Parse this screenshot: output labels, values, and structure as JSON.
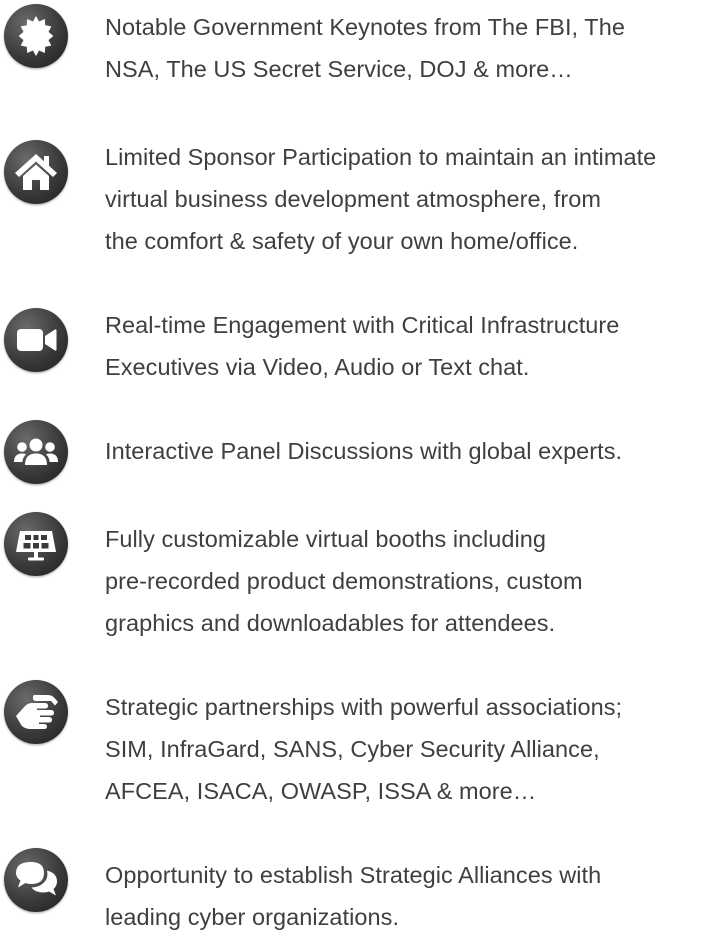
{
  "features": [
    {
      "icon": "badge-star-icon",
      "lines": [
        "Notable Government Keynotes from The FBI, The",
        "NSA, The US Secret Service, DOJ & more…"
      ]
    },
    {
      "icon": "home-icon",
      "lines": [
        "Limited Sponsor Participation to maintain an intimate",
        "virtual business development atmosphere, from",
        "the comfort & safety of your own home/office."
      ]
    },
    {
      "icon": "video-camera-icon",
      "lines": [
        "Real-time Engagement with Critical Infrastructure",
        "Executives via Video, Audio or Text chat."
      ]
    },
    {
      "icon": "users-icon",
      "lines": [
        "Interactive Panel Discussions with global experts."
      ]
    },
    {
      "icon": "solar-panel-icon",
      "lines": [
        "Fully customizable virtual booths including",
        "pre-recorded product demonstrations, custom",
        "graphics and downloadables for attendees."
      ]
    },
    {
      "icon": "handshake-icon",
      "lines": [
        "Strategic partnerships with powerful associations;",
        "SIM, InfraGard, SANS, Cyber Security Alliance,",
        "AFCEA, ISACA, OWASP, ISSA & more…"
      ]
    },
    {
      "icon": "comments-icon",
      "lines": [
        "Opportunity to establish Strategic Alliances with",
        "leading cyber organizations."
      ]
    }
  ]
}
